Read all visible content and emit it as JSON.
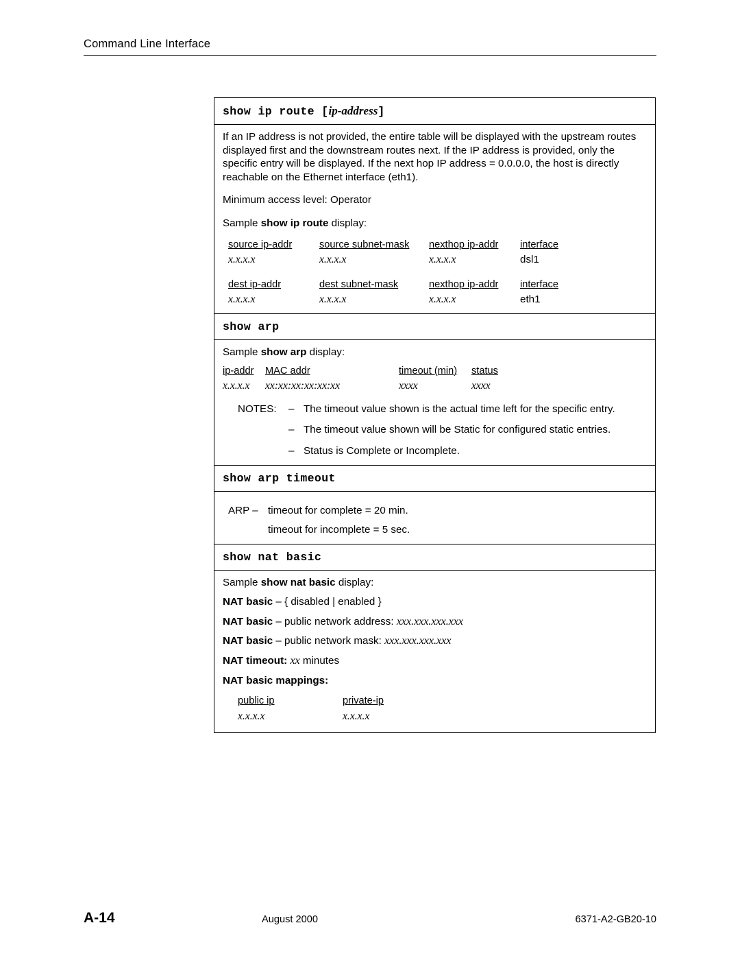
{
  "header": {
    "title": "Command Line Interface"
  },
  "sections": [
    {
      "id": "show-ip-route",
      "command_prefix": "show ip route",
      "command_arg": "ip-address",
      "bracket_open": "[",
      "bracket_close": "]",
      "paragraphs": [
        "If an IP address is not provided, the entire table will be displayed with the upstream routes displayed first and the downstream routes next. If the IP address is provided, only the specific entry will be displayed. If the next hop IP address = 0.0.0.0, the host is directly reachable on the Ethernet interface (eth1).",
        "Minimum access level:  Operator"
      ],
      "sample_label_pre": "Sample ",
      "sample_label_bold": "show ip route",
      "sample_label_post": " display:",
      "table1_headers": [
        "source ip-addr",
        "source subnet-mask",
        "nexthop ip-addr",
        "interface"
      ],
      "table1_values": [
        "x.x.x.x",
        "x.x.x.x",
        "x.x.x.x",
        "dsl1"
      ],
      "table2_headers": [
        "dest ip-addr",
        "dest subnet-mask",
        "nexthop ip-addr",
        "interface"
      ],
      "table2_values": [
        "x.x.x.x",
        "x.x.x.x",
        "x.x.x.x",
        "eth1"
      ]
    },
    {
      "id": "show-arp",
      "command_prefix": "show arp",
      "sample_label_pre": "Sample ",
      "sample_label_bold": "show arp",
      "sample_label_post": " display:",
      "headers": [
        "ip-addr",
        "MAC addr",
        "timeout (min)",
        "status"
      ],
      "values": [
        "x.x.x.x",
        "xx:xx:xx:xx:xx:xx",
        "xxxx",
        "xxxx"
      ],
      "notes_label": "NOTES:",
      "notes": [
        "The timeout value shown is the actual time left for the specific entry.",
        "The timeout value shown will be Static for configured static entries.",
        "Status is Complete or Incomplete."
      ],
      "dash": "–"
    },
    {
      "id": "show-arp-timeout",
      "command_prefix": "show arp timeout",
      "lines": [
        {
          "label": "ARP –",
          "text": "timeout for complete = 20 min."
        },
        {
          "label": "",
          "text": "timeout for incomplete = 5 sec."
        }
      ]
    },
    {
      "id": "show-nat-basic",
      "command_prefix": "show nat basic",
      "sample_label_pre": "Sample ",
      "sample_label_bold": "show nat basic",
      "sample_label_post": " display:",
      "nat_lines": [
        {
          "bold": "NAT basic",
          "plain": " – { disabled | enabled }",
          "italic": ""
        },
        {
          "bold": "NAT basic",
          "plain": " – public network address:  ",
          "italic": "xxx.xxx.xxx.xxx"
        },
        {
          "bold": "NAT basic",
          "plain": " – public network mask:  ",
          "italic": "xxx.xxx.xxx.xxx"
        },
        {
          "bold": "NAT timeout:",
          "plain": " ",
          "italic": "xx",
          "trailing": " minutes"
        },
        {
          "bold": "NAT basic mappings:",
          "plain": "",
          "italic": ""
        }
      ],
      "map_headers": [
        "public ip",
        "private-ip"
      ],
      "map_values": [
        "x.x.x.x",
        "x.x.x.x"
      ]
    }
  ],
  "footer": {
    "page_number": "A-14",
    "date": "August 2000",
    "doc_number": "6371-A2-GB20-10"
  }
}
